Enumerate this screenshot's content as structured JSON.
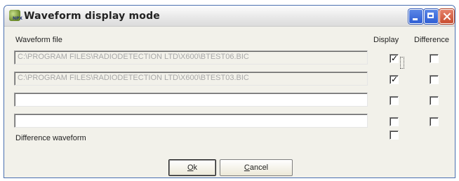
{
  "window": {
    "title": "Waveform display mode",
    "icon_name": "app-icon",
    "icon_badge": "NPX"
  },
  "headers": {
    "waveform_file": "Waveform file",
    "display": "Display",
    "difference": "Difference"
  },
  "rows": [
    {
      "file": "C:\\PROGRAM FILES\\RADIODETECTION LTD\\X600\\BTEST06.BIC",
      "display": true,
      "difference": false,
      "enabled": false
    },
    {
      "file": "C:\\PROGRAM FILES\\RADIODETECTION LTD\\X600\\BTEST03.BIC",
      "display": true,
      "difference": false,
      "enabled": false
    },
    {
      "file": "",
      "display": false,
      "difference": false,
      "enabled": true
    },
    {
      "file": "",
      "display": false,
      "difference": false,
      "enabled": true
    }
  ],
  "difference_waveform": {
    "label": "Difference waveform",
    "checked": false
  },
  "buttons": {
    "ok_mnemonic": "O",
    "ok_rest": "k",
    "cancel_mnemonic": "C",
    "cancel_rest": "ancel"
  },
  "colors": {
    "titlebar_button_blue": "#2f5ed4",
    "close_button_red": "#c94d2f",
    "disabled_text": "#a8a8a8"
  }
}
